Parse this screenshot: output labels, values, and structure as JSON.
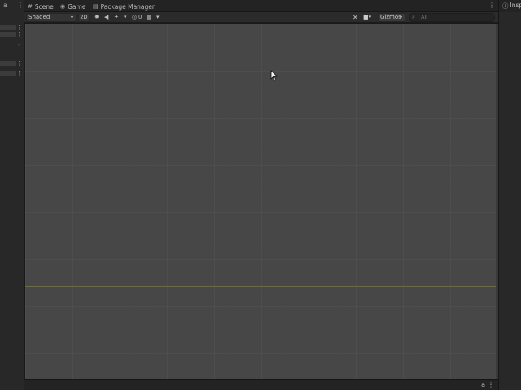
{
  "tabs": [
    {
      "label": "Scene",
      "icon": "hash-icon"
    },
    {
      "label": "Game",
      "icon": "gamepad-icon"
    },
    {
      "label": "Package Manager",
      "icon": "package-icon"
    }
  ],
  "toolbar": {
    "shading_mode": "Shaded",
    "mode_2d": "2D",
    "gizmos_label": "Gizmos",
    "search_placeholder": "All"
  },
  "inspector": {
    "tab_label": "Inspe"
  },
  "colors": {
    "scene_bg": "#474747",
    "x_axis": "#5d5e8a",
    "z_axis": "#6b6b45"
  }
}
